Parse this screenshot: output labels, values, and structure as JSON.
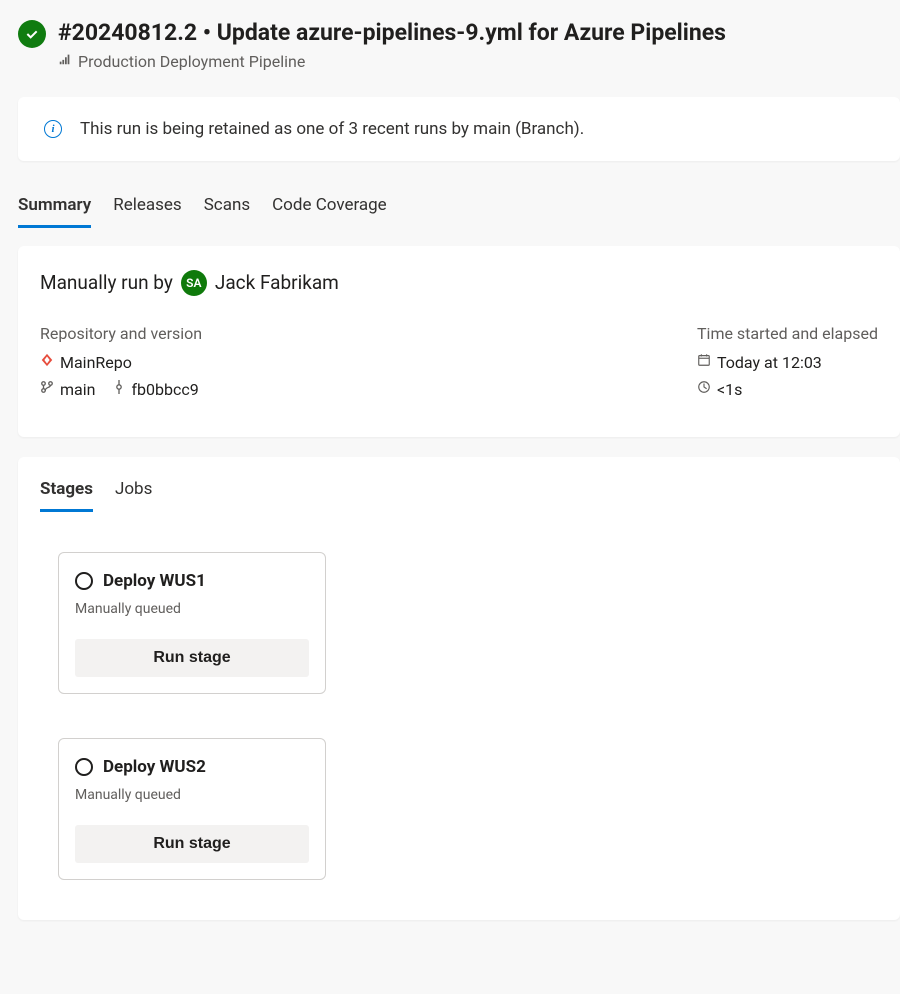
{
  "header": {
    "title": "#20240812.2 • Update azure-pipelines-9.yml for Azure Pipelines",
    "subtitle": "Production Deployment Pipeline"
  },
  "retention_notice": "This run is being retained as one of 3 recent runs by main (Branch).",
  "tabs": [
    {
      "label": "Summary",
      "active": true
    },
    {
      "label": "Releases",
      "active": false
    },
    {
      "label": "Scans",
      "active": false
    },
    {
      "label": "Code Coverage",
      "active": false
    }
  ],
  "run_info": {
    "run_by_prefix": "Manually run by",
    "avatar_initials": "SA",
    "user_name": "Jack Fabrikam",
    "repo_heading": "Repository and version",
    "repo_name": "MainRepo",
    "branch": "main",
    "commit": "fb0bbcc9",
    "time_heading": "Time started and elapsed",
    "started": "Today at 12:03",
    "elapsed": "<1s"
  },
  "stages_section": {
    "tabs": [
      {
        "label": "Stages",
        "active": true
      },
      {
        "label": "Jobs",
        "active": false
      }
    ],
    "stages": [
      {
        "name": "Deploy WUS1",
        "status": "Manually queued",
        "button": "Run stage"
      },
      {
        "name": "Deploy WUS2",
        "status": "Manually queued",
        "button": "Run stage"
      }
    ]
  }
}
